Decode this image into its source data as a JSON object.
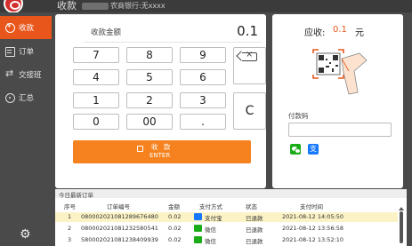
{
  "app": {
    "title": "收款",
    "bank_label": "农商银行:无xxxx"
  },
  "sidebar": {
    "items": [
      {
        "label": "收款",
        "icon": "cash-register-icon",
        "active": true
      },
      {
        "label": "订单",
        "icon": "order-icon",
        "active": false
      },
      {
        "label": "交接班",
        "icon": "shift-handover-icon",
        "active": false
      },
      {
        "label": "汇总",
        "icon": "summary-icon",
        "active": false
      }
    ],
    "settings_icon": "gear-icon"
  },
  "keypad": {
    "amount_label": "收款金额",
    "amount_value": "0.1",
    "keys": [
      "7",
      "8",
      "9",
      "4",
      "5",
      "6",
      "1",
      "2",
      "3",
      "0",
      "00",
      "."
    ],
    "clear_label": "C",
    "backspace_icon": "backspace-icon",
    "pay_button_label": "收 款",
    "pay_button_sub": "ENTER"
  },
  "qr": {
    "due_label": "应收:",
    "due_amount": "0.1",
    "due_unit": "元",
    "payment_code_label": "付款码",
    "payment_code_value": "",
    "methods": [
      "wechat-pay-icon",
      "alipay-icon"
    ]
  },
  "orders": {
    "title": "今日最新订单",
    "columns": [
      "序号",
      "订单编号",
      "金额",
      "支付方式",
      "状态",
      "支付时间"
    ],
    "rows": [
      {
        "no": "1",
        "order_id": "080002021081289676480",
        "amount": "0.02",
        "method": "支付宝",
        "method_icon": "alipay",
        "status": "已退款",
        "time": "2021-08-12 14:05:50"
      },
      {
        "no": "2",
        "order_id": "080002021081232580541",
        "amount": "0.02",
        "method": "微信",
        "method_icon": "wechat",
        "status": "已退款",
        "time": "2021-08-12 13:56:58"
      },
      {
        "no": "3",
        "order_id": "580002021081238409939",
        "amount": "0.02",
        "method": "微信",
        "method_icon": "wechat",
        "status": "已退款",
        "time": "2021-08-12 13:52:10"
      }
    ]
  },
  "colors": {
    "accent": "#e8561c",
    "pay_button": "#f5821f",
    "sidebar_bg": "#4a4a4a",
    "highlight_row": "#fbf3c6"
  }
}
